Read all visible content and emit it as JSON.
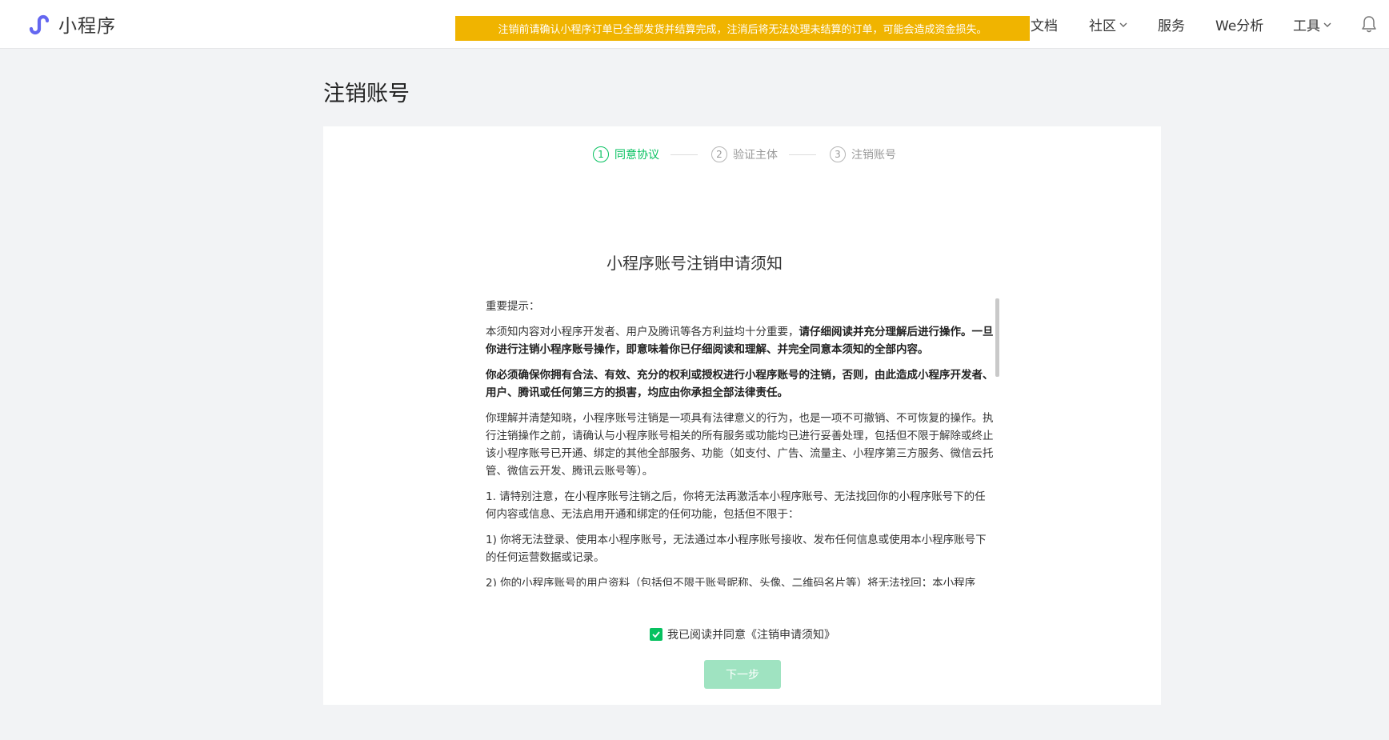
{
  "header": {
    "app_name": "小程序",
    "nav": [
      {
        "label": "文档"
      },
      {
        "label": "社区"
      },
      {
        "label": "服务"
      },
      {
        "label": "We分析"
      },
      {
        "label": "工具"
      }
    ]
  },
  "banner": {
    "text": "注销前请确认小程序订单已全部发货并结算完成，注消后将无法处理未结算的订单，可能会造成资金损失。"
  },
  "page_title": "注销账号",
  "steps": [
    {
      "num": "1",
      "label": "同意协议"
    },
    {
      "num": "2",
      "label": "验证主体"
    },
    {
      "num": "3",
      "label": "注销账号"
    }
  ],
  "notice": {
    "title": "小程序账号注销申请须知",
    "p1": "重要提示：",
    "p2_normal": "本须知内容对小程序开发者、用户及腾讯等各方利益均十分重要，",
    "p2_bold": "请仔细阅读并充分理解后进行操作。一旦你进行注销小程序账号操作，即意味着你已仔细阅读和理解、并完全同意本须知的全部内容。",
    "p3_bold": "你必须确保你拥有合法、有效、充分的权利或授权进行小程序账号的注销，否则，由此造成小程序开发者、用户、腾讯或任何第三方的损害，均应由你承担全部法律责任。",
    "p4": "你理解并清楚知晓，小程序账号注销是一项具有法律意义的行为，也是一项不可撤销、不可恢复的操作。执行注销操作之前，请确认与小程序账号相关的所有服务或功能均已进行妥善处理，包括但不限于解除或终止该小程序账号已开通、绑定的其他全部服务、功能（如支付、广告、流量主、小程序第三方服务、微信云托管、微信云开发、腾讯云账号等）。",
    "p5": "1. 请特别注意，在小程序账号注销之后，你将无法再激活本小程序账号、无法找回你的小程序账号下的任何内容或信息、无法启用开通和绑定的任何功能，包括但不限于：",
    "p6": "1) 你将无法登录、使用本小程序账号，无法通过本小程序账号接收、发布任何信息或使用本小程序账号下的任何运营数据或记录。",
    "p7": "2) 你的小程序账号的用户资料（包括但不限于账号昵称、头像、二维码名片等）将无法找回；本小程序"
  },
  "agree": {
    "text": "我已阅读并同意《注销申请须知》",
    "checked": true
  },
  "next_button": {
    "label": "下一步",
    "enabled": false
  },
  "colors": {
    "accent": "#07c160",
    "banner_bg": "#f0b400",
    "button_disabled": "#9fe3c1"
  }
}
